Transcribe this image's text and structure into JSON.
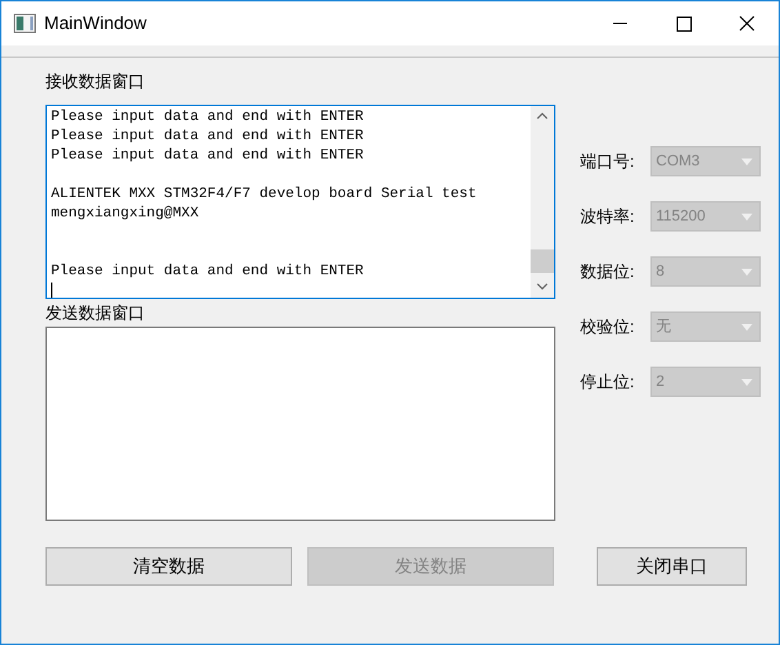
{
  "window": {
    "title": "MainWindow"
  },
  "receive": {
    "label": "接收数据窗口",
    "value": "Please input data and end with ENTER\nPlease input data and end with ENTER\nPlease input data and end with ENTER\n\nALIENTEK MXX STM32F4/F7 develop board Serial test\nmengxiangxing@MXX\n\n\nPlease input data and end with ENTER",
    "focused": true
  },
  "send": {
    "label": "发送数据窗口",
    "focused": false
  },
  "settings": [
    {
      "label": "端口号:",
      "value": "COM3",
      "disabled": true
    },
    {
      "label": "波特率:",
      "value": "115200",
      "disabled": true
    },
    {
      "label": "数据位:",
      "value": "8",
      "disabled": true
    },
    {
      "label": "校验位:",
      "value": "无",
      "disabled": true
    },
    {
      "label": "停止位:",
      "value": "2",
      "disabled": true
    }
  ],
  "buttons": [
    {
      "label": "清空数据",
      "disabled": false
    },
    {
      "label": "发送数据",
      "disabled": true
    },
    {
      "label": "关闭串口",
      "disabled": false
    }
  ]
}
